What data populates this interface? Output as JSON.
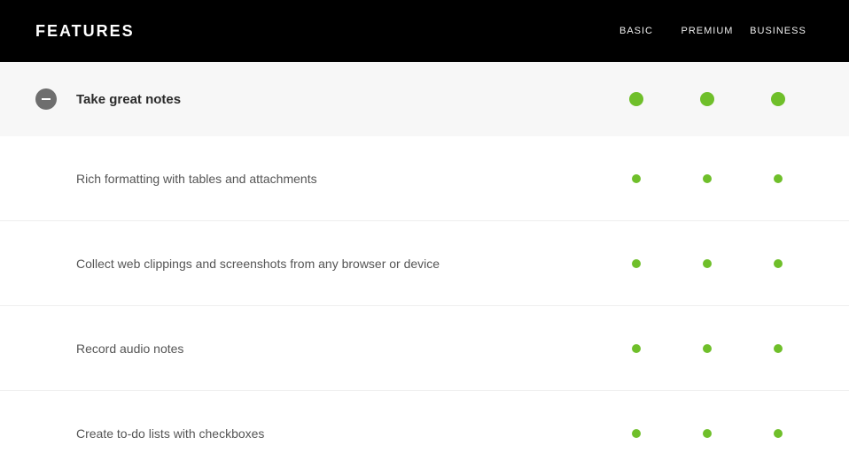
{
  "header": {
    "title": "FEATURES",
    "plans": [
      "BASIC",
      "PREMIUM",
      "BUSINESS"
    ]
  },
  "colors": {
    "dot": "#6fbf2a"
  },
  "category": {
    "label": "Take great notes",
    "expanded": true,
    "availability": [
      true,
      true,
      true
    ]
  },
  "features": [
    {
      "label": "Rich formatting with tables and attachments",
      "availability": [
        true,
        true,
        true
      ]
    },
    {
      "label": "Collect web clippings and screenshots from any browser or device",
      "availability": [
        true,
        true,
        true
      ]
    },
    {
      "label": "Record audio notes",
      "availability": [
        true,
        true,
        true
      ]
    },
    {
      "label": "Create to-do lists with checkboxes",
      "availability": [
        true,
        true,
        true
      ]
    }
  ]
}
